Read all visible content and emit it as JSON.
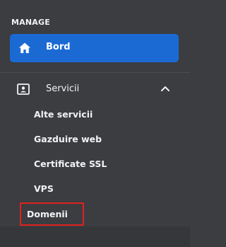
{
  "sidebar": {
    "section_label": "MANAGE",
    "active_item": {
      "label": "Bord",
      "icon": "home-icon"
    },
    "group": {
      "label": "Servicii",
      "icon": "id-card-icon",
      "expanded": true,
      "items": [
        {
          "label": "Alte servicii"
        },
        {
          "label": "Gazduire web"
        },
        {
          "label": "Certificate SSL"
        },
        {
          "label": "VPS"
        },
        {
          "label": "Domenii",
          "highlighted": true
        }
      ]
    }
  },
  "colors": {
    "background": "#3b3d40",
    "accent": "#1b6ad4",
    "highlight_border": "#e0201e",
    "text": "#f2f3f5"
  }
}
